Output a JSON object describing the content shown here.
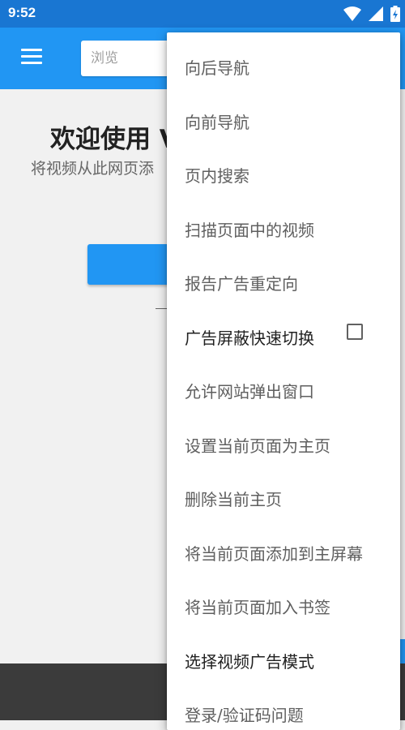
{
  "status_bar": {
    "time": "9:52",
    "icons": [
      "wifi-icon",
      "signal-icon",
      "battery-icon"
    ]
  },
  "toolbar": {
    "search_placeholder": "浏览"
  },
  "main": {
    "welcome_title": "欢迎使用 V",
    "welcome_subtitle": "将视频从此网页添"
  },
  "menu": {
    "items": [
      {
        "label": "向后导航",
        "enabled": false
      },
      {
        "label": "向前导航",
        "enabled": false
      },
      {
        "label": "页内搜索",
        "enabled": false
      },
      {
        "label": "扫描页面中的视频",
        "enabled": false
      },
      {
        "label": "报告广告重定向",
        "enabled": false
      },
      {
        "label": "广告屏蔽快速切换",
        "enabled": true,
        "checkbox": true,
        "checked": false
      },
      {
        "label": "允许网站弹出窗口",
        "enabled": false
      },
      {
        "label": "设置当前页面为主页",
        "enabled": false
      },
      {
        "label": "删除当前主页",
        "enabled": false
      },
      {
        "label": "将当前页面添加到主屏幕",
        "enabled": false
      },
      {
        "label": "将当前页面加入书签",
        "enabled": false
      },
      {
        "label": "选择视频广告模式",
        "enabled": true
      },
      {
        "label": "登录/验证码问题",
        "enabled": false
      }
    ]
  },
  "colors": {
    "status_bar": "#1976d2",
    "toolbar": "#2196f3",
    "accent": "#2196f3",
    "bottom_bar": "#3b3b3b"
  }
}
